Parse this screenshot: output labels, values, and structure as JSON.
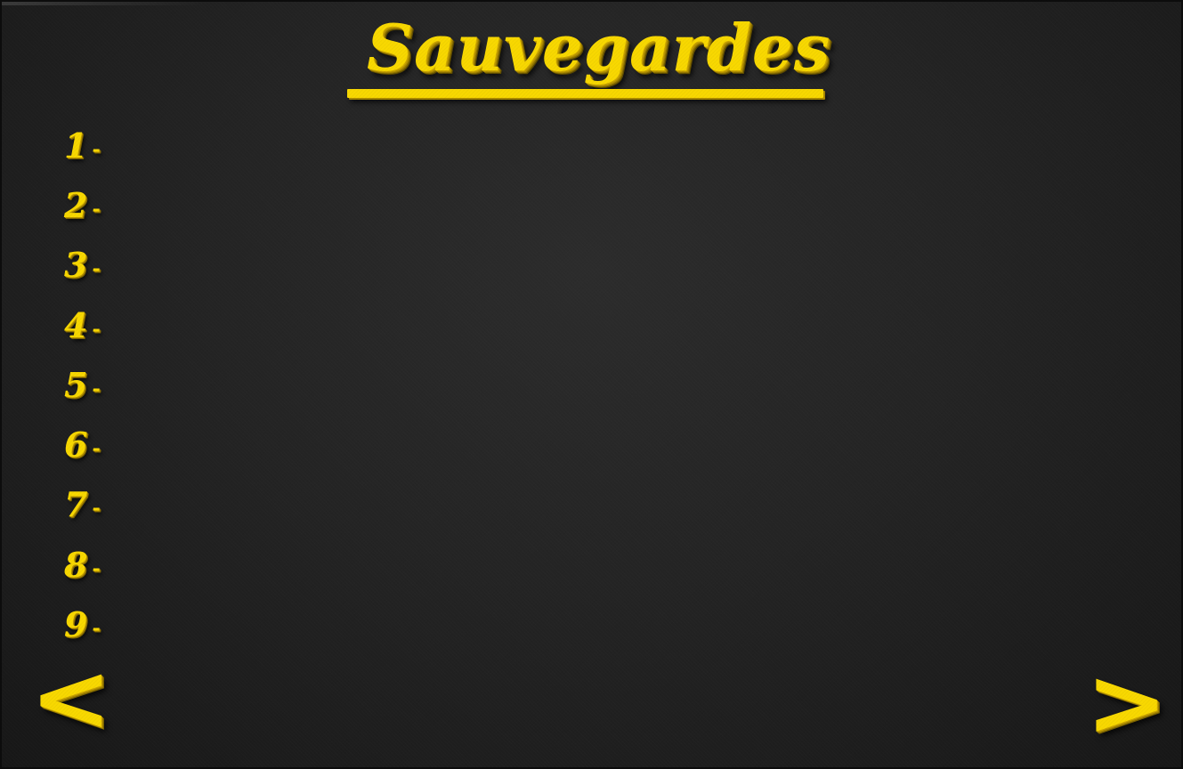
{
  "screen": {
    "title": "Sauvegardes"
  },
  "slots": [
    {
      "number": "1",
      "separator": "-",
      "name": ""
    },
    {
      "number": "2",
      "separator": "-",
      "name": ""
    },
    {
      "number": "3",
      "separator": "-",
      "name": ""
    },
    {
      "number": "4",
      "separator": "-",
      "name": ""
    },
    {
      "number": "5",
      "separator": "-",
      "name": ""
    },
    {
      "number": "6",
      "separator": "-",
      "name": ""
    },
    {
      "number": "7",
      "separator": "-",
      "name": ""
    },
    {
      "number": "8",
      "separator": "-",
      "name": ""
    },
    {
      "number": "9",
      "separator": "-",
      "name": ""
    }
  ],
  "navigation": {
    "prev_label": "<",
    "next_label": ">"
  },
  "colors": {
    "accent": "#f8d800",
    "background": "#242424"
  }
}
